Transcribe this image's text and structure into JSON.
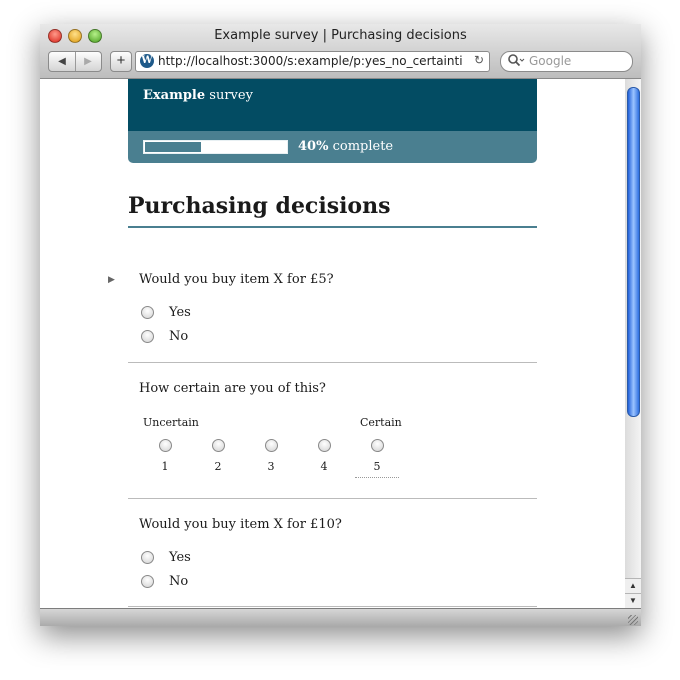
{
  "window": {
    "title": "Example survey | Purchasing decisions",
    "url": "http://localhost:3000/s:example/p:yes_no_certainti",
    "search_placeholder": "Google",
    "nav_back": "◀",
    "nav_forward": "▶",
    "add_label": "+",
    "reload_icon": "↻"
  },
  "survey": {
    "brand_bold": "Example",
    "brand_rest": " survey",
    "progress_percent": 40,
    "progress_value": "40%",
    "progress_suffix": " complete"
  },
  "page": {
    "title": "Purchasing decisions"
  },
  "questions": [
    {
      "text": "Would you buy item X for £5?",
      "options": [
        "Yes",
        "No"
      ]
    },
    {
      "text": "How certain are you of this?",
      "scale_low": "Uncertain",
      "scale_high": "Certain",
      "scale_values": [
        "1",
        "2",
        "3",
        "4",
        "5"
      ]
    },
    {
      "text": "Would you buy item X for £10?",
      "options": [
        "Yes",
        "No"
      ]
    }
  ],
  "colors": {
    "header": "#034c63",
    "progress_band": "#4a7f90"
  }
}
